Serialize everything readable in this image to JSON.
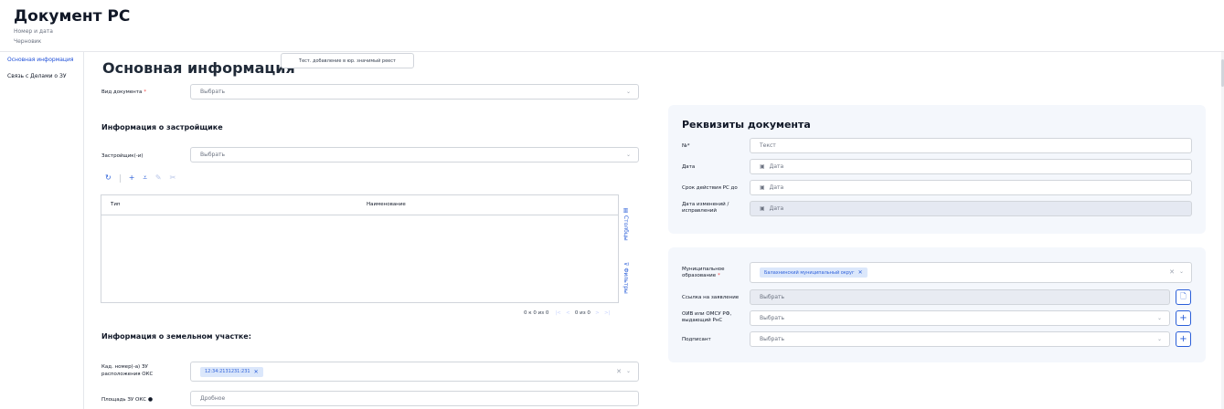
{
  "header": {
    "title": "Документ РС",
    "subtitle": "Номер и дата",
    "status": "Черновик"
  },
  "sidebar": {
    "items": [
      {
        "label": "Основная информация",
        "active": true
      },
      {
        "label": "Связь с Делами о ЗУ",
        "active": false
      }
    ]
  },
  "main": {
    "title": "Основная информация",
    "test_button_label": "Тест. добавление в юр. значимый реест",
    "doc_type": {
      "label": "Вид документа",
      "required_mark": "*",
      "value": "Выбрать"
    },
    "developer_section": {
      "title": "Информация о застройщике",
      "field_label": "Застройщик(-и)",
      "field_value": "Выбрать"
    },
    "toolbar": {
      "icons": [
        "refresh-icon",
        "add-icon",
        "chart-icon",
        "edit-icon",
        "delete-icon"
      ]
    },
    "table": {
      "columns": [
        "Тип",
        "Наименование"
      ],
      "side_tabs": {
        "columns": "Столбцы",
        "filters": "Фильтры"
      },
      "pager": {
        "range": "0 к 0 из 0",
        "first": "|<",
        "prev": "<",
        "page": "0 из 0",
        "next": ">",
        "last": ">|"
      }
    },
    "land_section": {
      "title": "Информация о земельном участке:",
      "cad_label_line1": "Кад. номер(-а) ЗУ",
      "cad_label_line2": "расположения ОКС",
      "cad_tag": "12:34:2131231:231",
      "area_label": "Площадь ЗУ ОКС",
      "area_placeholder": "Дробное"
    }
  },
  "requisites": {
    "title": "Реквизиты документа",
    "number_label": "№*",
    "number_placeholder": "Текст",
    "date_label": "Дата",
    "date_placeholder": "Дата",
    "valid_label": "Срок действия РС до",
    "valid_placeholder": "Дата",
    "change_label_line1": "Дата изменений /",
    "change_label_line2": "исправлений",
    "change_placeholder": "Дата"
  },
  "municipal": {
    "mo_label_line1": "Муниципальное",
    "mo_label_line2": "образование",
    "required_mark": "*",
    "mo_tag": "Балахнинский муниципальный округ",
    "statement_label": "Ссылка на заявление",
    "statement_value": "Выбрать",
    "oiv_label_line1": "ОИВ или ОМСУ РФ,",
    "oiv_label_line2": "выдающий РнС",
    "oiv_value": "Выбрать",
    "signer_label": "Подписант",
    "signer_value": "Выбрать"
  },
  "colors": {
    "accent": "#2b5fd9",
    "card_bg": "#f4f7fc",
    "border": "#d1d5db",
    "required": "#ef4444"
  }
}
